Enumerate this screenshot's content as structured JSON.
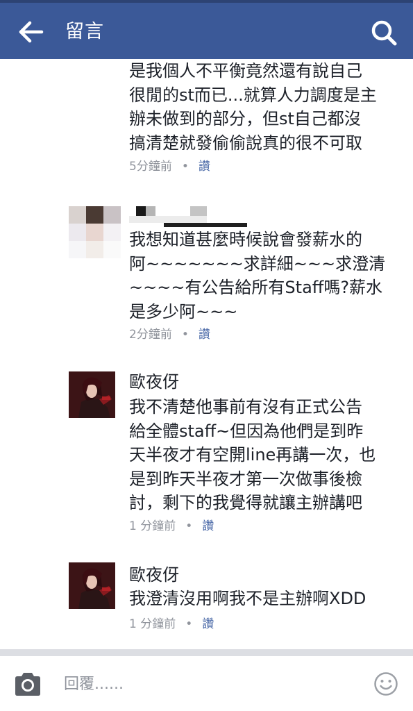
{
  "header": {
    "title": "留言",
    "back_icon": "arrow-left-icon",
    "search_icon": "search-icon",
    "background": "#3b5998"
  },
  "comments": [
    {
      "author": "",
      "text": "是我個人不平衡竟然還有說自己\n很閒的st而已...就算人力調度是主\n辦未做到的部分，但st自己都沒\n搞清楚就發偷偷說真的很不可取",
      "time": "5分鐘前",
      "dot": "•",
      "like": "讚"
    },
    {
      "author": "",
      "text": "我想知道甚麼時候說會發薪水的\n阿~~~~~~~求詳細~~~求澄清\n~~~~有公告給所有Staff嗎?薪水\n是多少阿~~~",
      "time": "2分鐘前",
      "dot": "•",
      "like": "讚"
    },
    {
      "author": "歐夜伢",
      "text": "我不清楚他事前有沒有正式公告\n給全體staff~但因為他們是到昨\n天半夜才有空開line再講一次，也\n是到昨天半夜才第一次做事後檢\n討，剩下的我覺得就讓主辦講吧",
      "time": "1 分鐘前",
      "dot": "•",
      "like": "讚"
    },
    {
      "author": "歐夜伢",
      "text": "我澄清沒用啊我不是主辦啊XDD",
      "time": "1 分鐘前",
      "dot": "•",
      "like": "讚"
    }
  ],
  "composer": {
    "placeholder": "回覆......",
    "camera_icon": "camera-icon",
    "emoji_icon": "smiley-icon"
  },
  "colors": {
    "header": "#3b5998",
    "meta_text": "#90949c",
    "like_link": "#4b6aa8",
    "divider": "#dcdee3"
  }
}
